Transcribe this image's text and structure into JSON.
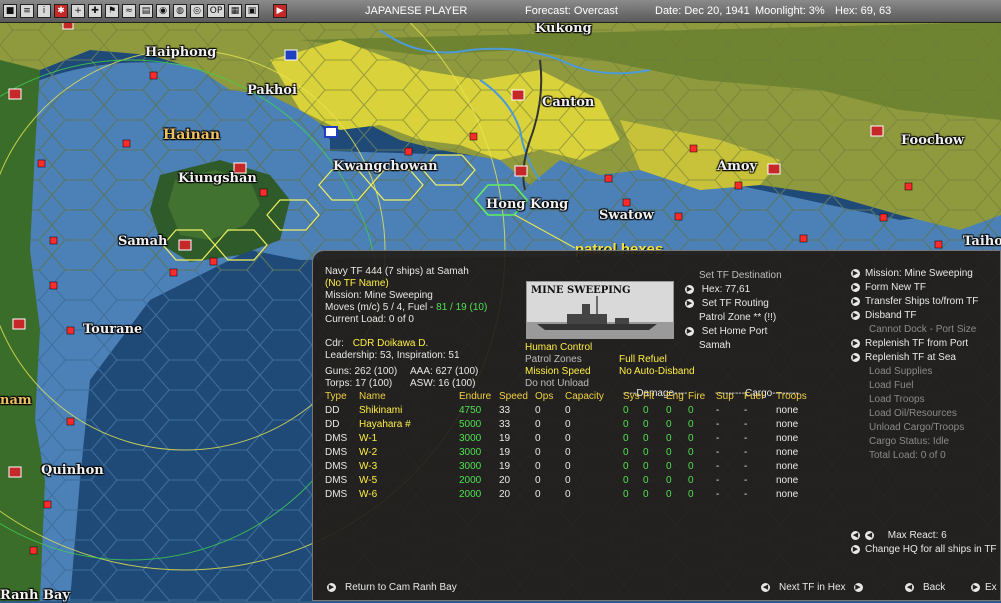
{
  "toolbar": {
    "player": "JAPANESE PLAYER",
    "forecast": "Forecast: Overcast",
    "date": "Date: Dec 20, 1941",
    "moonlight": "Moonlight: 3%",
    "hex": "Hex: 69, 63",
    "buttons": [
      "■",
      "≡",
      "i",
      "✱",
      "+",
      "✚",
      "⚑",
      "≈",
      "▤",
      "◉",
      "◍",
      "◎",
      "OP",
      "▦",
      "▣",
      "▶"
    ],
    "button_icons": [
      "square-icon",
      "list-icon",
      "info-icon",
      "sun-flag-icon",
      "plane-icon",
      "cross-icon",
      "flag-icon",
      "ship-icon",
      "grid-icon",
      "globe-icon",
      "earth-icon",
      "target-icon",
      "op-icon",
      "table-icon",
      "screen-icon",
      "play-icon"
    ]
  },
  "map": {
    "places": [
      "Kukong",
      "Haiphong",
      "Pakhoi",
      "Canton",
      "Hainan",
      "Kwangchowan",
      "Kiungshan",
      "Amoy",
      "Foochow",
      "Hong Kong",
      "Swatow",
      "Samah",
      "Taihol",
      "Tourane",
      "Quinhon",
      "nam",
      "Ranh Bay"
    ],
    "annotation": "patrol hexes"
  },
  "panel": {
    "tf_title": "Navy TF 444 (7 ships) at Samah",
    "tf_name": "(No TF Name)",
    "mission": "Mission: Mine Sweeping",
    "moves_prefix": "Moves (m/c) 5 / 4, Fuel -",
    "moves_fuel": "81 / 19 (10)",
    "current_load": "Current Load: 0 of 0",
    "cdr_label": "Cdr:",
    "cdr_name": "CDR Doikawa D.",
    "leadership": "Leadership: 53, Inspiration: 51",
    "guns": "Guns: 262 (100)",
    "aaa": "AAA: 627 (100)",
    "torps": "Torps: 17 (100)",
    "asw": "ASW: 16 (100)",
    "photo_title": "MINE SWEEPING",
    "human_control": "Human Control",
    "patrol_zones": "Patrol Zones",
    "mission_speed": "Mission Speed",
    "do_not_unload": "Do not Unload",
    "full_refuel": "Full Refuel",
    "no_auto_disband": "No Auto-Disband",
    "set_tf_destination": "Set TF Destination",
    "dest_hex": "Hex: 77,61",
    "set_tf_routing": "Set TF Routing",
    "patrol_zone_info": "Patrol Zone ** (!!)",
    "set_home_port": "Set Home Port",
    "home_port": "Samah",
    "right_menu": {
      "mission": "Mission: Mine Sweeping",
      "form_new_tf": "Form New TF",
      "transfer_ships": "Transfer Ships to/from TF",
      "disband_tf": "Disband TF",
      "cannot_dock": "Cannot Dock - Port Size",
      "replenish_port": "Replenish TF from Port",
      "replenish_sea": "Replenish TF at Sea",
      "load_supplies": "Load Supplies",
      "load_fuel": "Load Fuel",
      "load_troops": "Load Troops",
      "load_oil": "Load Oil/Resources",
      "unload_cargo": "Unload Cargo/Troops",
      "cargo_status": "Cargo Status: Idle",
      "total_load": "Total Load: 0 of 0"
    },
    "max_react": "Max React: 6",
    "change_hq": "Change HQ for all ships in TF",
    "return_to": "Return to Cam Ranh Bay",
    "next_tf": "Next TF in Hex",
    "back": "Back",
    "exit": "Ex",
    "table": {
      "damage_header": "----Damage----",
      "cargo_header": "---------Cargo--------",
      "columns": [
        "Type",
        "Name",
        "Endure",
        "Speed",
        "Ops",
        "Capacity",
        "Sys",
        "Flt",
        "Eng",
        "Fire",
        "Sup",
        "Fuel",
        "Troops"
      ],
      "rows": [
        {
          "type": "DD",
          "name": "Shikinami",
          "endure": "4750",
          "speed": "33",
          "ops": "0",
          "capacity": "0",
          "sys": "0",
          "flt": "0",
          "eng": "0",
          "fire": "0",
          "sup": "-",
          "fuel": "-",
          "troops": "none"
        },
        {
          "type": "DD",
          "name": "Hayahara #",
          "endure": "5000",
          "speed": "33",
          "ops": "0",
          "capacity": "0",
          "sys": "0",
          "flt": "0",
          "eng": "0",
          "fire": "0",
          "sup": "-",
          "fuel": "-",
          "troops": "none"
        },
        {
          "type": "DMS",
          "name": "W-1",
          "endure": "3000",
          "speed": "19",
          "ops": "0",
          "capacity": "0",
          "sys": "0",
          "flt": "0",
          "eng": "0",
          "fire": "0",
          "sup": "-",
          "fuel": "-",
          "troops": "none"
        },
        {
          "type": "DMS",
          "name": "W-2",
          "endure": "3000",
          "speed": "19",
          "ops": "0",
          "capacity": "0",
          "sys": "0",
          "flt": "0",
          "eng": "0",
          "fire": "0",
          "sup": "-",
          "fuel": "-",
          "troops": "none"
        },
        {
          "type": "DMS",
          "name": "W-3",
          "endure": "3000",
          "speed": "19",
          "ops": "0",
          "capacity": "0",
          "sys": "0",
          "flt": "0",
          "eng": "0",
          "fire": "0",
          "sup": "-",
          "fuel": "-",
          "troops": "none"
        },
        {
          "type": "DMS",
          "name": "W-5",
          "endure": "2000",
          "speed": "20",
          "ops": "0",
          "capacity": "0",
          "sys": "0",
          "flt": "0",
          "eng": "0",
          "fire": "0",
          "sup": "-",
          "fuel": "-",
          "troops": "none"
        },
        {
          "type": "DMS",
          "name": "W-6",
          "endure": "2000",
          "speed": "20",
          "ops": "0",
          "capacity": "0",
          "sys": "0",
          "flt": "0",
          "eng": "0",
          "fire": "0",
          "sup": "-",
          "fuel": "-",
          "troops": "none"
        }
      ]
    }
  }
}
